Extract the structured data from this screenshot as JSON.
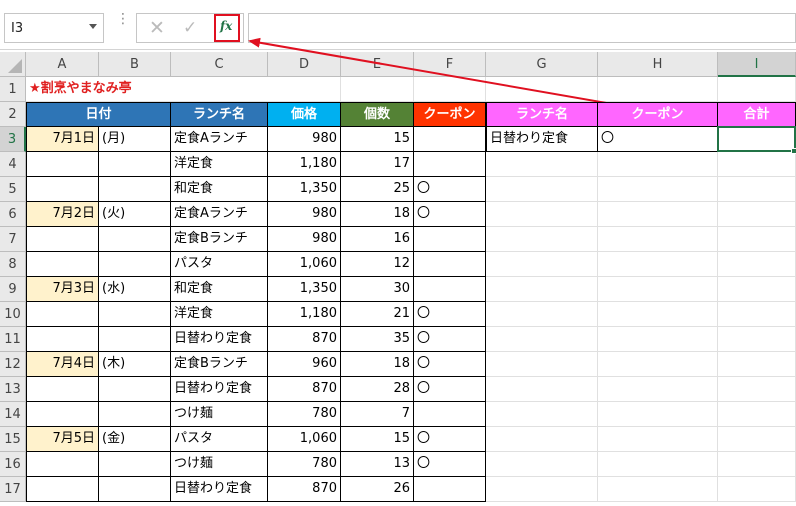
{
  "formula_bar": {
    "name_box": "I3",
    "cancel_glyph": "✕",
    "enter_glyph": "✓",
    "fx_label": "fx",
    "formula": ""
  },
  "colors": {
    "blue_header": "#2e75b6",
    "cyan_header": "#00b0f0",
    "green_header": "#548235",
    "red_header": "#ff3300",
    "magenta_header": "#ff66ff",
    "date_fill": "#fff2cc",
    "arrow": "#e01020",
    "accent": "#217346"
  },
  "icons": {
    "cancel": "cancel-icon",
    "enter": "check-icon",
    "insert_function": "fx-icon",
    "select_all": "select-all-icon",
    "dropdown": "chevron-down-icon"
  },
  "columns": [
    "A",
    "B",
    "C",
    "D",
    "E",
    "F",
    "G",
    "H",
    "I"
  ],
  "active_column": "I",
  "active_row": "3",
  "title": "★割烹やまなみ亭",
  "header": {
    "date": "日付",
    "lunch": "ランチ名",
    "price": "価格",
    "qty": "個数",
    "coupon": "クーポン",
    "g_lunch": "ランチ名",
    "h_coupon": "クーポン",
    "total": "合計"
  },
  "criteria": {
    "lunch": "日替わり定食",
    "coupon": "〇"
  },
  "rows": [
    {
      "num": "3",
      "date": "7月1日",
      "dow": "(月)",
      "lunch": "定食Aランチ",
      "price": "980",
      "qty": "15",
      "coupon": ""
    },
    {
      "num": "4",
      "date": "",
      "dow": "",
      "lunch": "洋定食",
      "price": "1,180",
      "qty": "17",
      "coupon": ""
    },
    {
      "num": "5",
      "date": "",
      "dow": "",
      "lunch": "和定食",
      "price": "1,350",
      "qty": "25",
      "coupon": "〇"
    },
    {
      "num": "6",
      "date": "7月2日",
      "dow": "(火)",
      "lunch": "定食Aランチ",
      "price": "980",
      "qty": "18",
      "coupon": "〇"
    },
    {
      "num": "7",
      "date": "",
      "dow": "",
      "lunch": "定食Bランチ",
      "price": "980",
      "qty": "16",
      "coupon": ""
    },
    {
      "num": "8",
      "date": "",
      "dow": "",
      "lunch": "パスタ",
      "price": "1,060",
      "qty": "12",
      "coupon": ""
    },
    {
      "num": "9",
      "date": "7月3日",
      "dow": "(水)",
      "lunch": "和定食",
      "price": "1,350",
      "qty": "30",
      "coupon": ""
    },
    {
      "num": "10",
      "date": "",
      "dow": "",
      "lunch": "洋定食",
      "price": "1,180",
      "qty": "21",
      "coupon": "〇"
    },
    {
      "num": "11",
      "date": "",
      "dow": "",
      "lunch": "日替わり定食",
      "price": "870",
      "qty": "35",
      "coupon": "〇"
    },
    {
      "num": "12",
      "date": "7月4日",
      "dow": "(木)",
      "lunch": "定食Bランチ",
      "price": "960",
      "qty": "18",
      "coupon": "〇"
    },
    {
      "num": "13",
      "date": "",
      "dow": "",
      "lunch": "日替わり定食",
      "price": "870",
      "qty": "28",
      "coupon": "〇"
    },
    {
      "num": "14",
      "date": "",
      "dow": "",
      "lunch": "つけ麺",
      "price": "780",
      "qty": "7",
      "coupon": ""
    },
    {
      "num": "15",
      "date": "7月5日",
      "dow": "(金)",
      "lunch": "パスタ",
      "price": "1,060",
      "qty": "15",
      "coupon": "〇"
    },
    {
      "num": "16",
      "date": "",
      "dow": "",
      "lunch": "つけ麺",
      "price": "780",
      "qty": "13",
      "coupon": "〇"
    },
    {
      "num": "17",
      "date": "",
      "dow": "",
      "lunch": "日替わり定食",
      "price": "870",
      "qty": "26",
      "coupon": ""
    }
  ]
}
